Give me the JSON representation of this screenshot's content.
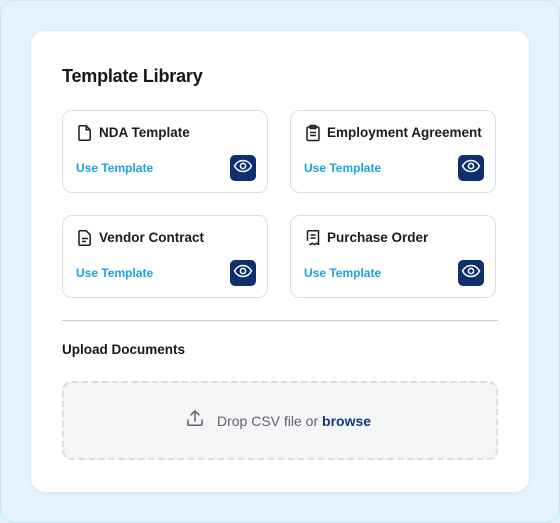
{
  "library": {
    "title": "Template Library",
    "templates": [
      {
        "name": "NDA Template",
        "icon": "document-icon",
        "action": "Use Template",
        "view_icon": "eye-icon"
      },
      {
        "name": "Employment Agreement",
        "icon": "clipboard-icon",
        "action": "Use Template",
        "view_icon": "eye-icon"
      },
      {
        "name": "Vendor Contract",
        "icon": "contract-icon",
        "action": "Use Template",
        "view_icon": "eye-icon"
      },
      {
        "name": "Purchase Order",
        "icon": "receipt-icon",
        "action": "Use Template",
        "view_icon": "eye-icon"
      }
    ]
  },
  "upload": {
    "title": "Upload Documents",
    "drop_text": "Drop CSV file or",
    "browse_label": "browse",
    "icon": "upload-icon"
  },
  "colors": {
    "background": "#e2f1fc",
    "card": "#ffffff",
    "link": "#1aa3e0",
    "view_button": "#0e2e6e",
    "browse": "#123a7a"
  }
}
